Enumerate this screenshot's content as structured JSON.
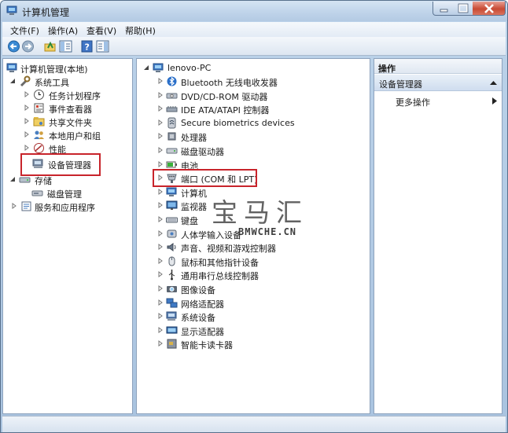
{
  "window": {
    "title": "计算机管理"
  },
  "menubar": [
    {
      "label": "文件(F)"
    },
    {
      "label": "操作(A)"
    },
    {
      "label": "查看(V)"
    },
    {
      "label": "帮助(H)"
    }
  ],
  "left_tree": {
    "root": "计算机管理(本地)",
    "system_tools": "系统工具",
    "task_scheduler": "任务计划程序",
    "event_viewer": "事件查看器",
    "shared_folders": "共享文件夹",
    "local_users": "本地用户和组",
    "performance": "性能",
    "device_manager": "设备管理器",
    "storage": "存储",
    "disk_management": "磁盘管理",
    "services_apps": "服务和应用程序"
  },
  "device_tree": {
    "root": "lenovo-PC",
    "items": [
      {
        "label": "Bluetooth 无线电收发器",
        "icon": "bluetooth-icon"
      },
      {
        "label": "DVD/CD-ROM 驱动器",
        "icon": "dvd-drive-icon"
      },
      {
        "label": "IDE ATA/ATAPI 控制器",
        "icon": "ide-controller-icon"
      },
      {
        "label": "Secure biometrics devices",
        "icon": "biometric-icon"
      },
      {
        "label": "处理器",
        "icon": "processor-icon"
      },
      {
        "label": "磁盘驱动器",
        "icon": "disk-drive-icon"
      },
      {
        "label": "电池",
        "icon": "battery-icon"
      },
      {
        "label": "端口 (COM 和 LPT)",
        "icon": "port-icon"
      },
      {
        "label": "计算机",
        "icon": "computer-icon"
      },
      {
        "label": "监视器",
        "icon": "monitor-icon"
      },
      {
        "label": "键盘",
        "icon": "keyboard-icon"
      },
      {
        "label": "人体学输入设备",
        "icon": "hid-icon"
      },
      {
        "label": "声音、视频和游戏控制器",
        "icon": "sound-icon"
      },
      {
        "label": "鼠标和其他指针设备",
        "icon": "mouse-icon"
      },
      {
        "label": "通用串行总线控制器",
        "icon": "usb-icon"
      },
      {
        "label": "图像设备",
        "icon": "camera-icon"
      },
      {
        "label": "网络适配器",
        "icon": "network-icon"
      },
      {
        "label": "系统设备",
        "icon": "system-device-icon"
      },
      {
        "label": "显示适配器",
        "icon": "display-adapter-icon"
      },
      {
        "label": "智能卡读卡器",
        "icon": "smartcard-icon"
      }
    ]
  },
  "actions": {
    "header": "操作",
    "section": "设备管理器",
    "more": "更多操作"
  },
  "watermark": {
    "big": "宝马汇",
    "small": "BMWCHE.CN"
  }
}
